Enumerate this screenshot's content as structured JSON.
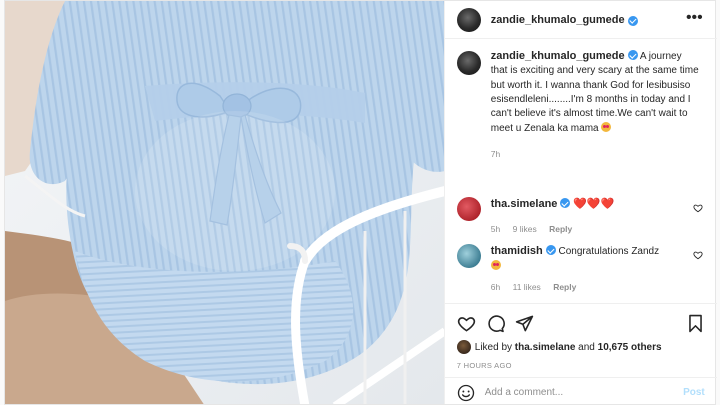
{
  "post": {
    "username": "zandie_khumalo_gumede",
    "more_icon": "more-horizontal-icon",
    "caption": "A journey that is exciting and very scary at the same time but worth it. I wanna thank God for lesibusiso esisendleleni........I'm 8 months in today and I can't believe it's almost time.We can't wait to meet u Zenala ka mama",
    "caption_time": "7h",
    "photo_icon": "photo-pregnant-woman-blue-knit-dress"
  },
  "comments": [
    {
      "username": "tha.simelane",
      "text": "",
      "hearts": "❤️❤️❤️",
      "time": "5h",
      "likes": "9 likes",
      "reply": "Reply",
      "avatar_color": "#c8323a"
    },
    {
      "username": "thamidish",
      "text": "Congratulations Zandz",
      "time": "6h",
      "likes": "11 likes",
      "reply": "Reply",
      "avatar_color": "#6aa7b8"
    }
  ],
  "liked_by": {
    "prefix": "Liked by",
    "user": "tha.simelane",
    "middle": "and",
    "count": "10,675 others"
  },
  "posted_ago": "7 HOURS AGO",
  "add_comment": {
    "placeholder": "Add a comment...",
    "post_label": "Post"
  },
  "colors": {
    "dress": "#b9d3ec",
    "verified": "#3897f0",
    "post_button": "#b2dffc"
  }
}
